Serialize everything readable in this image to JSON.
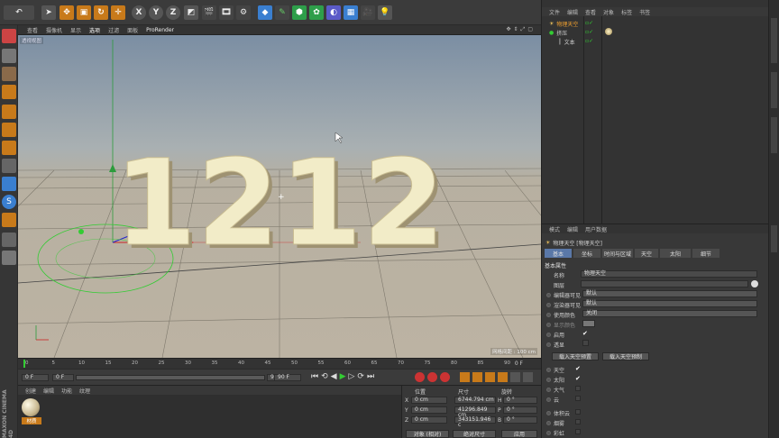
{
  "viewport": {
    "menu": [
      "查看",
      "摄像机",
      "显示",
      "选项",
      "过滤",
      "面板",
      "ProRender"
    ],
    "label": "透视视图",
    "text3d": "1212",
    "grid_spacing": "网格间距 : 100 cm"
  },
  "timeline": {
    "ticks": [
      "0",
      "5",
      "10",
      "15",
      "20",
      "25",
      "30",
      "35",
      "40",
      "45",
      "50",
      "55",
      "60",
      "65",
      "70",
      "75",
      "80",
      "85",
      "90"
    ],
    "end_label": "0 F"
  },
  "ctrl": {
    "start": "0 F",
    "current": "0 F",
    "end": "90 F",
    "end2": "90 F"
  },
  "materials": {
    "menu": [
      "创建",
      "编辑",
      "功能",
      "纹理"
    ],
    "item_label": "材质"
  },
  "coords": {
    "headers": [
      "位置",
      "尺寸",
      "旋转"
    ],
    "rows": [
      {
        "axis": "X",
        "pos": "0 cm",
        "size": "6744.794 cm",
        "rot_label": "H",
        "rot": "0 °"
      },
      {
        "axis": "Y",
        "pos": "0 cm",
        "size": "41296.849 cm",
        "rot_label": "P",
        "rot": "0 °"
      },
      {
        "axis": "Z",
        "pos": "0 cm",
        "size": "343151.946 c",
        "rot_label": "B",
        "rot": "0 °"
      }
    ],
    "mode1": "对象 (相对)",
    "mode2": "绝对尺寸",
    "apply": "应用"
  },
  "objects": {
    "menu": [
      "文件",
      "编辑",
      "查看",
      "对象",
      "标签",
      "书签"
    ],
    "items": [
      "物理天空",
      "挤压",
      "文本"
    ]
  },
  "attributes": {
    "menu": [
      "模式",
      "编辑",
      "用户数据"
    ],
    "title": "物理天空 [物理天空]",
    "tabs": [
      "基本",
      "坐标",
      "时间与区域",
      "天空",
      "太阳",
      "细节"
    ],
    "section": "基本属性",
    "name_label": "名称",
    "name_value": "物理天空",
    "layer_label": "图层",
    "editor_vis_label": "编辑器可见",
    "editor_vis_value": "默认",
    "render_vis_label": "渲染器可见",
    "render_vis_value": "默认",
    "use_color_label": "使用颜色",
    "use_color_value": "关闭",
    "display_color_label": "显示颜色",
    "enable_label": "启用",
    "transparent_label": "透显",
    "load_preset": "载入天空预置",
    "save_preset": "载入天空预制",
    "checks": [
      "天空",
      "太阳",
      "大气",
      "云",
      "体积云",
      "烟雾",
      "彩虹"
    ]
  },
  "brand": "MAXON CINEMA 4D"
}
